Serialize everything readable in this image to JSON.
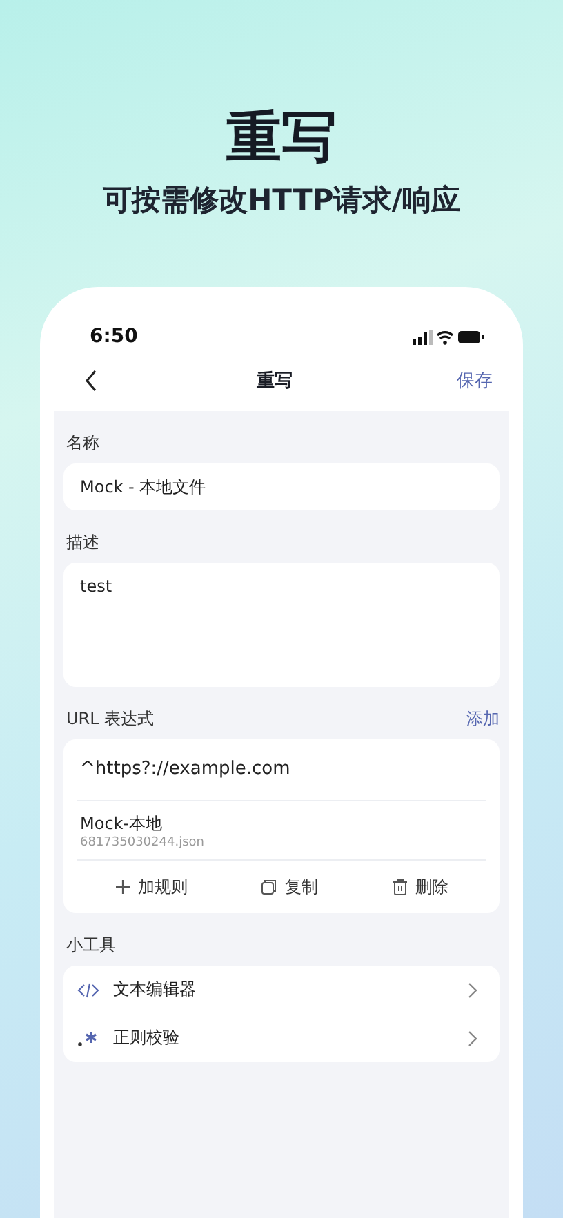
{
  "headline": {
    "title": "重写",
    "subtitle": "可按需修改HTTP请求/响应"
  },
  "status_bar": {
    "time": "6:50"
  },
  "nav": {
    "title": "重写",
    "action": "保存"
  },
  "name_field": {
    "label": "名称",
    "value": "Mock - 本地文件"
  },
  "description_field": {
    "label": "描述",
    "value": "test"
  },
  "url_section": {
    "label": "URL 表达式",
    "action": "添加",
    "pattern": "^https?://example.com",
    "rule_name": "Mock-本地",
    "rule_file": "681735030244.json",
    "actions": [
      {
        "kind": "add",
        "label": "加规则"
      },
      {
        "kind": "copy",
        "label": "复制"
      },
      {
        "kind": "delete",
        "label": "删除"
      }
    ]
  },
  "tools": {
    "label": "小工具",
    "items": [
      {
        "kind": "code",
        "label": "文本编辑器"
      },
      {
        "kind": "regex",
        "label": "正则校验"
      }
    ]
  }
}
